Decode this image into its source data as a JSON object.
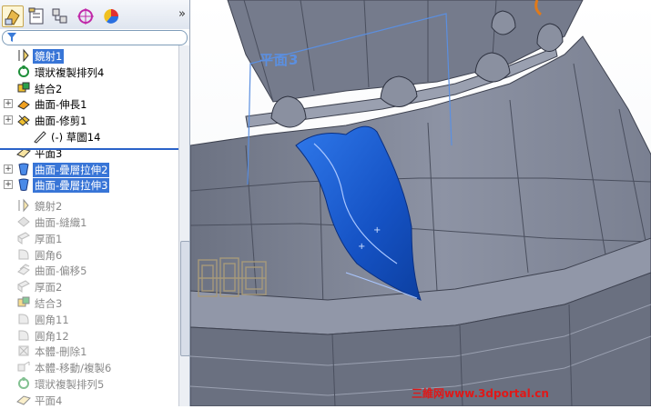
{
  "featuremanager": {
    "tabs": [
      {
        "name": "feature-manager-tab",
        "active": true
      },
      {
        "name": "property-manager-tab",
        "active": false
      },
      {
        "name": "configuration-manager-tab",
        "active": false
      },
      {
        "name": "dimxpert-manager-tab",
        "active": false
      },
      {
        "name": "display-manager-tab",
        "active": false
      }
    ],
    "expand_glyph": "»",
    "items": [
      {
        "label": "鏡射1",
        "selected": true,
        "suppressed": false,
        "expandable": false,
        "indent": 0,
        "icon": "mirror-icon"
      },
      {
        "label": "環狀複製排列4",
        "selected": false,
        "suppressed": false,
        "expandable": false,
        "indent": 0,
        "icon": "circular-pattern-icon"
      },
      {
        "label": "結合2",
        "selected": false,
        "suppressed": false,
        "expandable": false,
        "indent": 0,
        "icon": "combine-icon"
      },
      {
        "label": "曲面-伸長1",
        "selected": false,
        "suppressed": false,
        "expandable": true,
        "indent": 0,
        "icon": "surface-extrude-icon"
      },
      {
        "label": "曲面-修剪1",
        "selected": false,
        "suppressed": false,
        "expandable": true,
        "indent": 0,
        "icon": "surface-trim-icon"
      },
      {
        "label": "(-) 草圖14",
        "selected": false,
        "suppressed": false,
        "expandable": false,
        "indent": 1,
        "icon": "sketch-icon"
      },
      {
        "label": "平面3",
        "selected": false,
        "suppressed": false,
        "expandable": false,
        "indent": 0,
        "icon": "plane-icon"
      },
      {
        "label": "曲面-疊層拉伸2",
        "selected": true,
        "suppressed": false,
        "expandable": true,
        "indent": 0,
        "icon": "surface-loft-icon"
      },
      {
        "label": "曲面-疊層拉伸3",
        "selected": true,
        "suppressed": false,
        "expandable": true,
        "indent": 0,
        "icon": "surface-loft-icon"
      },
      {
        "label": "鏡射2",
        "selected": false,
        "suppressed": true,
        "expandable": false,
        "indent": 0,
        "icon": "mirror-icon"
      },
      {
        "label": "曲面-縫織1",
        "selected": false,
        "suppressed": true,
        "expandable": false,
        "indent": 0,
        "icon": "surface-knit-icon"
      },
      {
        "label": "厚面1",
        "selected": false,
        "suppressed": true,
        "expandable": false,
        "indent": 0,
        "icon": "thicken-icon"
      },
      {
        "label": "圓角6",
        "selected": false,
        "suppressed": true,
        "expandable": false,
        "indent": 0,
        "icon": "fillet-icon"
      },
      {
        "label": "曲面-偏移5",
        "selected": false,
        "suppressed": true,
        "expandable": false,
        "indent": 0,
        "icon": "surface-offset-icon"
      },
      {
        "label": "厚面2",
        "selected": false,
        "suppressed": true,
        "expandable": false,
        "indent": 0,
        "icon": "thicken-icon"
      },
      {
        "label": "結合3",
        "selected": false,
        "suppressed": true,
        "expandable": false,
        "indent": 0,
        "icon": "combine-icon"
      },
      {
        "label": "圓角11",
        "selected": false,
        "suppressed": true,
        "expandable": false,
        "indent": 0,
        "icon": "fillet-icon"
      },
      {
        "label": "圓角12",
        "selected": false,
        "suppressed": true,
        "expandable": false,
        "indent": 0,
        "icon": "fillet-icon"
      },
      {
        "label": "本體-刪除1",
        "selected": false,
        "suppressed": true,
        "expandable": false,
        "indent": 0,
        "icon": "delete-body-icon"
      },
      {
        "label": "本體-移動/複製6",
        "selected": false,
        "suppressed": true,
        "expandable": false,
        "indent": 0,
        "icon": "move-copy-body-icon"
      },
      {
        "label": "環狀複製排列5",
        "selected": false,
        "suppressed": true,
        "expandable": false,
        "indent": 0,
        "icon": "circular-pattern-icon"
      },
      {
        "label": "平面4",
        "selected": false,
        "suppressed": true,
        "expandable": false,
        "indent": 0,
        "icon": "plane-icon"
      }
    ]
  },
  "viewport": {
    "plane_label": "平面3",
    "watermark": "三維网www.3dportal.cn",
    "colors": {
      "model_gray": "#7d8394",
      "model_dark": "#4a4f5e",
      "selection_blue": "#1f5fd0",
      "plane_blue": "#5b8fe0",
      "watermark_red": "#e01818"
    }
  }
}
